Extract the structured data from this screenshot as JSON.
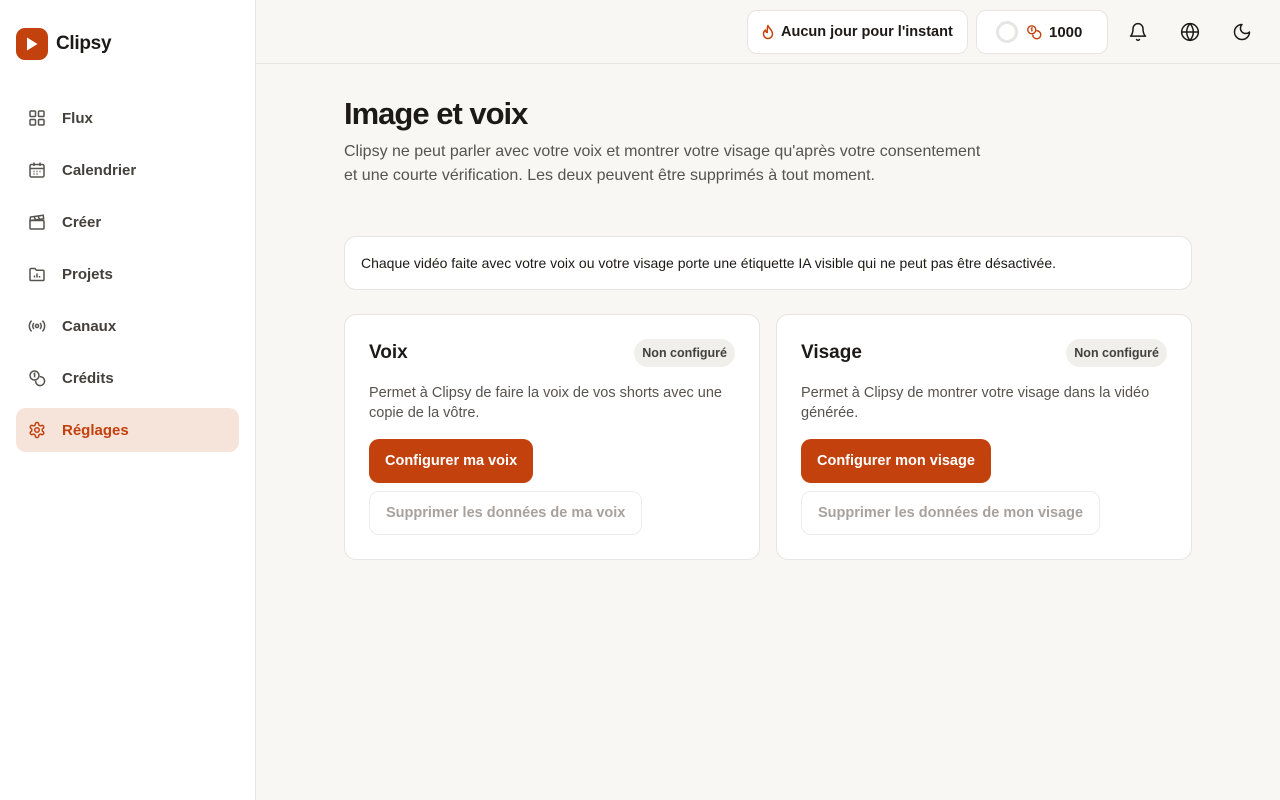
{
  "app": {
    "name": "Clipsy",
    "brand_color": "#c2410c"
  },
  "sidebar": {
    "items": [
      {
        "label": "Flux",
        "icon": "grid-icon"
      },
      {
        "label": "Calendrier",
        "icon": "calendar-icon"
      },
      {
        "label": "Créer",
        "icon": "clapperboard-icon"
      },
      {
        "label": "Projets",
        "icon": "folder-chart-icon"
      },
      {
        "label": "Canaux",
        "icon": "broadcast-icon"
      },
      {
        "label": "Crédits",
        "icon": "coins-icon"
      },
      {
        "label": "Réglages",
        "icon": "gear-icon",
        "active": true
      }
    ]
  },
  "topbar": {
    "streak_label": "Aucun jour pour l'instant",
    "credits_value": "1000"
  },
  "page": {
    "title": "Image et voix",
    "description": "Clipsy ne peut parler avec votre voix et montrer votre visage qu'après votre consentement et une courte vérification. Les deux peuvent être supprimés à tout moment.",
    "notice": "Chaque vidéo faite avec votre voix ou votre visage porte une étiquette IA visible qui ne peut pas être désactivée."
  },
  "cards": {
    "voice": {
      "title": "Voix",
      "status": "Non configuré",
      "description": "Permet à Clipsy de faire la voix de vos shorts avec une copie de la vôtre.",
      "primary_button": "Configurer ma voix",
      "delete_button": "Supprimer les données de ma voix"
    },
    "face": {
      "title": "Visage",
      "status": "Non configuré",
      "description": "Permet à Clipsy de montrer votre visage dans la vidéo générée.",
      "primary_button": "Configurer mon visage",
      "delete_button": "Supprimer les données de mon visage"
    }
  }
}
